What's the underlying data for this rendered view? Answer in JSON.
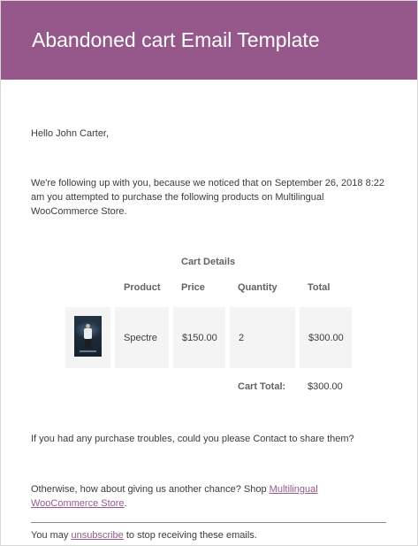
{
  "header": {
    "title": "Abandoned cart Email Template"
  },
  "body": {
    "greeting": "Hello John Carter,",
    "intro": "We're following up with you, because we noticed that on September 26, 2018 8:22 am you attempted to purchase the following products on Multilingual WooCommerce Store."
  },
  "cart": {
    "title": "Cart Details",
    "columns": [
      "Product",
      "Price",
      "Quantity",
      "Total"
    ],
    "rows": [
      {
        "image": "spectre-poster",
        "product": "Spectre",
        "price": "$150.00",
        "quantity": "2",
        "total": "$300.00"
      }
    ],
    "total_label": "Cart Total:",
    "total_value": "$300.00"
  },
  "messages": {
    "trouble": "If you had any purchase troubles, could you please Contact to share them?",
    "otherwise_prefix": "Otherwise, how about giving us another chance? Shop ",
    "shop_link": "Multilingual WooCommerce Store",
    "otherwise_suffix": "."
  },
  "footer": {
    "prefix": "You may ",
    "unsubscribe_link": "unsubscribe",
    "suffix": " to stop receiving these emails."
  },
  "colors": {
    "header_bg": "#96588a",
    "link": "#96588a",
    "cell_bg": "#f4f4f4"
  }
}
